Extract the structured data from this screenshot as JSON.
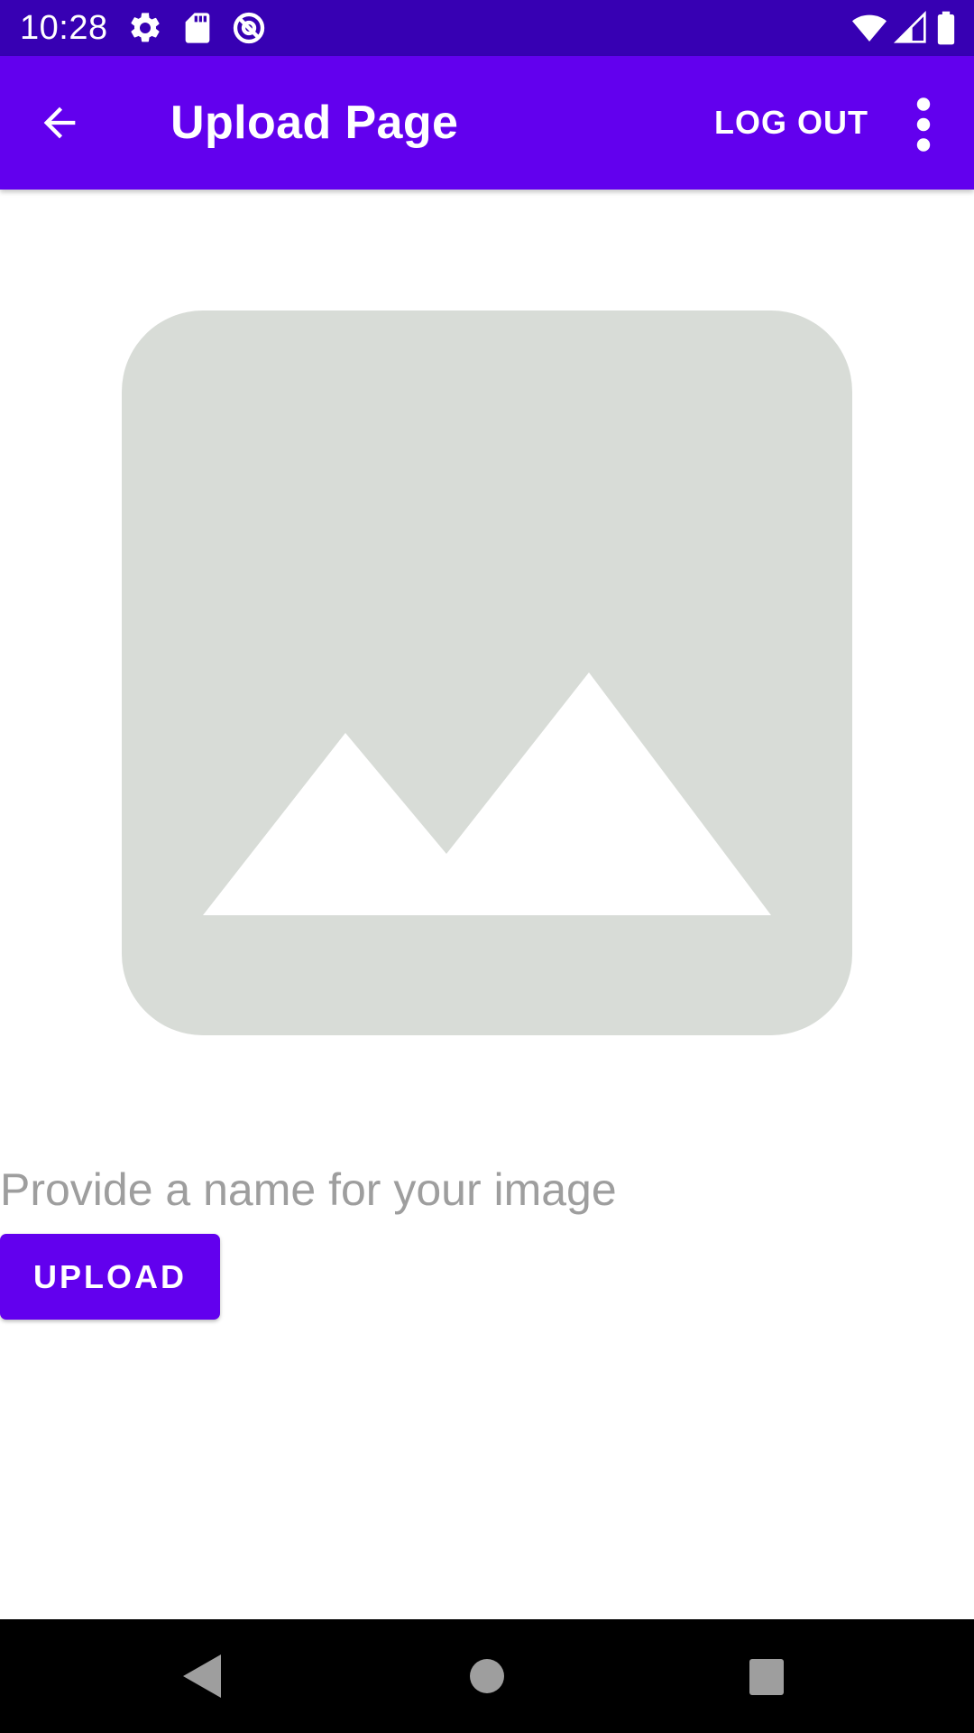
{
  "status_bar": {
    "time": "10:28",
    "icons_left": [
      "settings-icon",
      "sd-card-icon",
      "at-sign-icon"
    ],
    "icons_right": [
      "wifi-icon",
      "cell-signal-icon",
      "battery-icon"
    ]
  },
  "app_bar": {
    "back_icon": "arrow-back-icon",
    "title": "Upload Page",
    "logout_label": "LOG OUT",
    "overflow_icon": "more-vert-icon"
  },
  "content": {
    "image_placeholder_icon": "image-placeholder-icon",
    "name_input": {
      "value": "",
      "placeholder": "Provide a name for your image"
    },
    "upload_label": "UPLOAD"
  },
  "nav_bar": {
    "icons": [
      "back-triangle-icon",
      "home-circle-icon",
      "recents-square-icon"
    ]
  },
  "colors": {
    "status_bar": "#3700b3",
    "primary": "#6200ee",
    "placeholder_fill": "#d8dcd7",
    "placeholder_text": "#9e9e9e",
    "nav_bar": "#000000"
  }
}
